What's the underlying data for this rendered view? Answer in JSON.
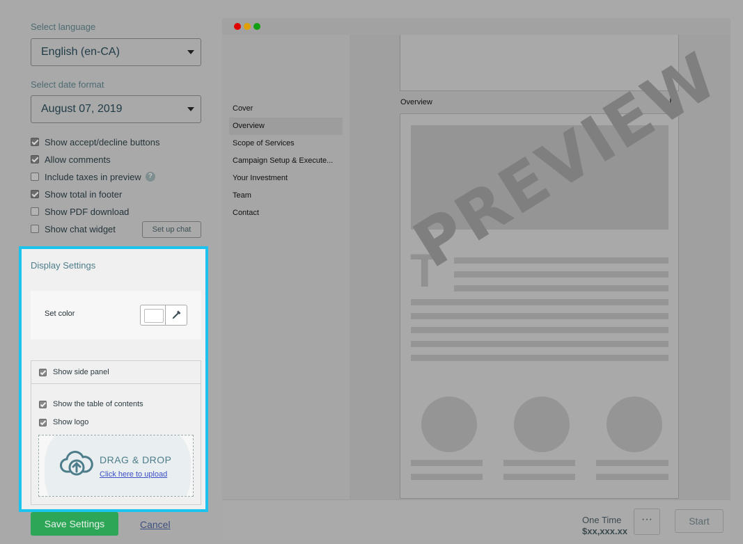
{
  "settings": {
    "language_label": "Select language",
    "language_value": "English (en-CA)",
    "date_label": "Select date format",
    "date_value": "August 07, 2019",
    "options": [
      {
        "label": "Show accept/decline buttons",
        "checked": true
      },
      {
        "label": "Allow comments",
        "checked": true
      },
      {
        "label": "Include taxes in preview",
        "checked": false
      },
      {
        "label": "Show total in footer",
        "checked": true
      },
      {
        "label": "Show PDF download",
        "checked": false
      },
      {
        "label": "Show chat widget",
        "checked": false
      }
    ],
    "help_glyph": "?",
    "chat_button": "Set up chat"
  },
  "display": {
    "title": "Display Settings",
    "set_color_label": "Set color",
    "show_side_panel": "Show side panel",
    "show_toc": "Show the table of contents",
    "show_logo": "Show logo",
    "drag_drop": "DRAG & DROP",
    "upload_link": "Click here to upload",
    "highlight_color": "#1cc3ee"
  },
  "actions": {
    "save": "Save Settings",
    "cancel": "Cancel"
  },
  "preview": {
    "toc": [
      "Cover",
      "Overview",
      "Scope of Services",
      "Campaign Setup & Execute...",
      "Your Investment",
      "Team",
      "Contact"
    ],
    "active_index": 1,
    "section_label": "Overview",
    "watermark": "PREVIEW",
    "price_label": "One Time",
    "price_value": "$xx,xxx.xx",
    "more_glyph": "···",
    "start": "Start",
    "window_dots": [
      "#e00000",
      "#e0a000",
      "#12a012"
    ]
  }
}
